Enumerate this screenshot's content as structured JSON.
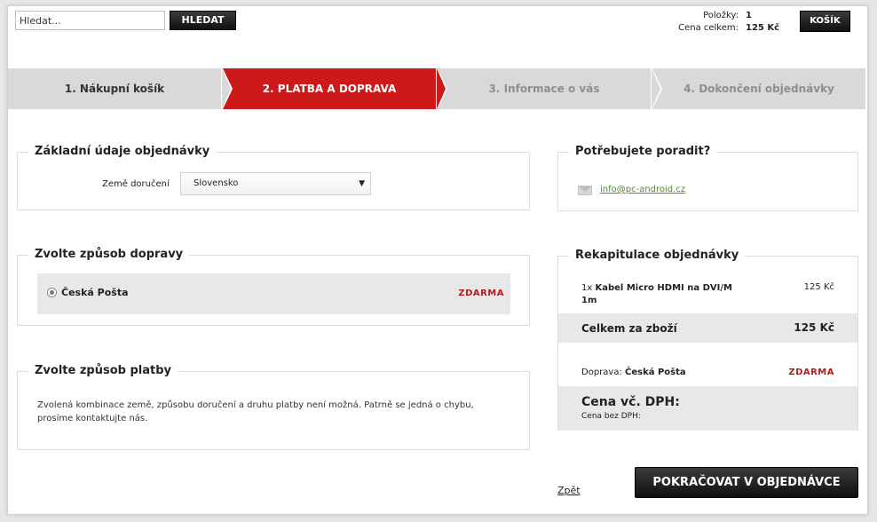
{
  "header": {
    "search_placeholder": "Hledat...",
    "search_button": "HLEDAT",
    "cart": {
      "items_label": "Položky:",
      "items_value": "1",
      "total_label": "Cena celkem:",
      "total_value": "125 Kč",
      "button": "KOŠÍK"
    }
  },
  "steps": [
    {
      "label": "1. Nákupní košík",
      "state": "done"
    },
    {
      "label": "2. PLATBA A DOPRAVA",
      "state": "active"
    },
    {
      "label": "3. Informace o vás",
      "state": "pending"
    },
    {
      "label": "4. Dokončení objednávky",
      "state": "pending"
    }
  ],
  "basic": {
    "title": "Základní údaje objednávky",
    "country_label": "Země doručení",
    "country_value": "Slovensko"
  },
  "shipping": {
    "title": "Zvolte způsob dopravy",
    "option_name": "Česká Pošta",
    "option_price": "ZDARMA"
  },
  "payment": {
    "title": "Zvolte způsob platby",
    "message": "Zvolená kombinace země, způsobu doručení a druhu platby není možná. Patrně se jedná o chybu, prosíme kontaktujte nás."
  },
  "help": {
    "title": "Potřebujete poradit?",
    "email": "info@pc-android.cz"
  },
  "recap": {
    "title": "Rekapitulace objednávky",
    "item_qty": "1x",
    "item_name": "Kabel Micro HDMI na DVI/M 1m",
    "item_price": "125 Kč",
    "total_label": "Celkem za zboží",
    "total_value": "125 Kč",
    "shipping_label": "Doprava:",
    "shipping_name": "Česká Pošta",
    "shipping_price": "ZDARMA",
    "vat_label": "Cena vč. DPH:",
    "novat_label": "Cena bez DPH:"
  },
  "footer": {
    "back_link": "Zpět",
    "continue_button": "POKRAČOVAT V OBJEDNÁVCE"
  },
  "colors": {
    "accent_red": "#cc1a1a",
    "price_red": "#b31b1b",
    "link_green": "#4e8a2a"
  }
}
